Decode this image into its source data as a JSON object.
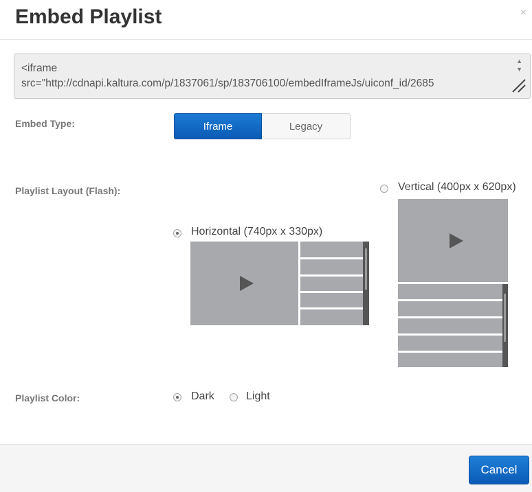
{
  "dialog": {
    "title": "Embed Playlist",
    "close_symbol": "×"
  },
  "embed_code": {
    "value_line1": "<iframe",
    "value_line2": "src=\"http://cdnapi.kaltura.com/p/1837061/sp/183706100/embedIframeJs/uiconf_id/2685"
  },
  "embed_type": {
    "label": "Embed Type:",
    "options": [
      "Iframe",
      "Legacy"
    ],
    "selected": "Iframe"
  },
  "playlist_layout": {
    "label": "Playlist Layout (Flash):",
    "horizontal": "Horizontal (740px x 330px)",
    "vertical": "Vertical (400px x 620px)",
    "selected": "horizontal"
  },
  "playlist_color": {
    "label": "Playlist Color:",
    "dark": "Dark",
    "light": "Light",
    "selected": "dark"
  },
  "footer": {
    "cancel_label": "Cancel"
  },
  "colors": {
    "primary": "#0b5bb5",
    "preview_gray": "#a8a9ac"
  }
}
